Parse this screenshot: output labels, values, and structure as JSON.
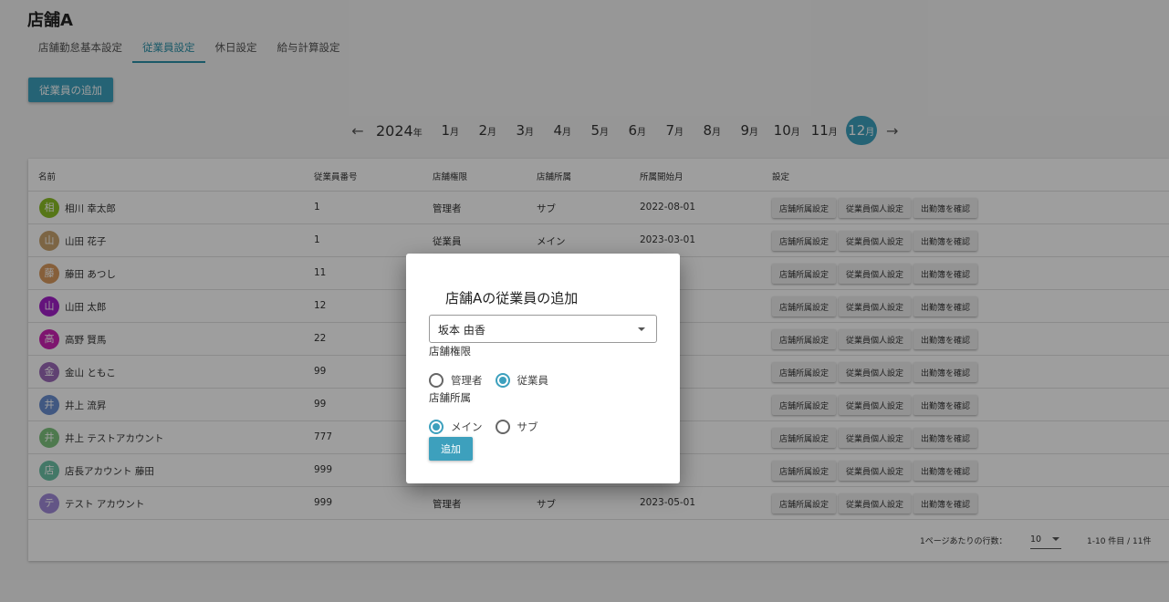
{
  "header": {
    "store_title": "店舗A"
  },
  "tabs": [
    {
      "label": "店舗勤怠基本設定",
      "active": false
    },
    {
      "label": "従業員設定",
      "active": true
    },
    {
      "label": "休日設定",
      "active": false
    },
    {
      "label": "給与計算設定",
      "active": false
    }
  ],
  "toolbar": {
    "add_employee_label": "従業員の追加"
  },
  "month_nav": {
    "prev_icon": "←",
    "next_icon": "→",
    "year": "2024",
    "year_suffix": "年",
    "month_suffix": "月",
    "months": [
      "1",
      "2",
      "3",
      "4",
      "5",
      "6",
      "7",
      "8",
      "9",
      "10",
      "11",
      "12"
    ],
    "selected_month": "12"
  },
  "table": {
    "headers": [
      "名前",
      "従業員番号",
      "店舗権限",
      "店舗所属",
      "所属開始月",
      "設定"
    ],
    "row_buttons": [
      "店舗所属設定",
      "従業員個人設定",
      "出勤簿を確認"
    ],
    "rows": [
      {
        "initial": "相",
        "color": "#8cbf26",
        "name": "相川 幸太郎",
        "number": "1",
        "role": "管理者",
        "affiliation": "サブ",
        "start": "2022-08-01"
      },
      {
        "initial": "山",
        "color": "#c8a46e",
        "name": "山田 花子",
        "number": "1",
        "role": "従業員",
        "affiliation": "メイン",
        "start": "2023-03-01"
      },
      {
        "initial": "藤",
        "color": "#d89a5e",
        "name": "藤田 あつし",
        "number": "11",
        "role": "",
        "affiliation": "",
        "start": "01"
      },
      {
        "initial": "山",
        "color": "#a21fc9",
        "name": "山田 太郎",
        "number": "12",
        "role": "",
        "affiliation": "",
        "start": "01"
      },
      {
        "initial": "高",
        "color": "#cc23b3",
        "name": "高野 賢馬",
        "number": "22",
        "role": "",
        "affiliation": "",
        "start": "01"
      },
      {
        "initial": "金",
        "color": "#9c6ab8",
        "name": "金山 ともこ",
        "number": "99",
        "role": "",
        "affiliation": "",
        "start": "01"
      },
      {
        "initial": "井",
        "color": "#6a8ed0",
        "name": "井上 流昇",
        "number": "99",
        "role": "",
        "affiliation": "",
        "start": "01"
      },
      {
        "initial": "井",
        "color": "#7fc47f",
        "name": "井上 テストアカウント",
        "number": "777",
        "role": "",
        "affiliation": "",
        "start": "01"
      },
      {
        "initial": "店",
        "color": "#6cc2a6",
        "name": "店長アカウント 藤田",
        "number": "999",
        "role": "",
        "affiliation": "",
        "start": "01"
      },
      {
        "initial": "テ",
        "color": "#a08ad8",
        "name": "テスト アカウント",
        "number": "999",
        "role": "管理者",
        "affiliation": "サブ",
        "start": "2023-05-01"
      }
    ],
    "footer": {
      "rows_per_page_label": "1ページあたりの行数：",
      "rows_per_page": "10",
      "page_info": "1-10 件目 / 11件"
    }
  },
  "dialog": {
    "title": "店舗Aの従業員の追加",
    "selected_employee": "坂本 由香",
    "role_label": "店舗権限",
    "role_options": [
      {
        "label": "管理者",
        "checked": false
      },
      {
        "label": "従業員",
        "checked": true
      }
    ],
    "affiliation_label": "店舗所属",
    "affiliation_options": [
      {
        "label": "メイン",
        "checked": true
      },
      {
        "label": "サブ",
        "checked": false
      }
    ],
    "submit_label": "追加"
  },
  "colors": {
    "accent": "#3da0bd",
    "overlay": "rgba(0,0,0,0.38)"
  }
}
